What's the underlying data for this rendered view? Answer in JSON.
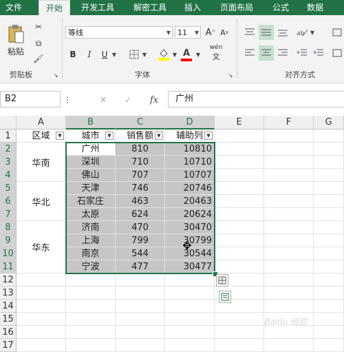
{
  "ribbon_tabs": [
    "文件",
    "开始",
    "开发工具",
    "解密工具",
    "插入",
    "页面布局",
    "公式",
    "数据"
  ],
  "active_tab": "开始",
  "clipboard": {
    "paste_label": "粘贴",
    "group_label": "剪贴板"
  },
  "font": {
    "name": "等线",
    "size": "11",
    "group_label": "字体",
    "bold": "B",
    "italic": "I",
    "underline": "U",
    "grow": "A",
    "shrink": "A",
    "pinyin": "wén"
  },
  "alignment": {
    "group_label": "对齐方式"
  },
  "name_box": "B2",
  "formula_content": "广州",
  "fx_label": "fx",
  "columns": [
    "A",
    "B",
    "C",
    "D",
    "E",
    "F",
    "G"
  ],
  "rows": [
    "1",
    "2",
    "3",
    "4",
    "5",
    "6",
    "7",
    "8",
    "9",
    "10",
    "11",
    "12",
    "13",
    "14",
    "15",
    "16",
    "17"
  ],
  "headers": {
    "region": "区域",
    "city": "城市",
    "sales": "销售额",
    "helper": "辅助列"
  },
  "regions": [
    "华南",
    "华北",
    "华东"
  ],
  "data_rows": [
    {
      "city": "广州",
      "sales": "810",
      "helper": "10810"
    },
    {
      "city": "深圳",
      "sales": "710",
      "helper": "10710"
    },
    {
      "city": "佛山",
      "sales": "707",
      "helper": "10707"
    },
    {
      "city": "天津",
      "sales": "746",
      "helper": "20746"
    },
    {
      "city": "石家庄",
      "sales": "463",
      "helper": "20463"
    },
    {
      "city": "太原",
      "sales": "624",
      "helper": "20624"
    },
    {
      "city": "济南",
      "sales": "470",
      "helper": "30470"
    },
    {
      "city": "上海",
      "sales": "799",
      "helper": "30799"
    },
    {
      "city": "南京",
      "sales": "544",
      "helper": "30544"
    },
    {
      "city": "宁波",
      "sales": "477",
      "helper": "30477"
    }
  ],
  "watermark": "Baidu 经验",
  "colors": {
    "excel_green": "#217346",
    "selection_fill": "#c6c6c6",
    "highlight_fill": "#ffff00",
    "font_red": "#ff0000"
  }
}
